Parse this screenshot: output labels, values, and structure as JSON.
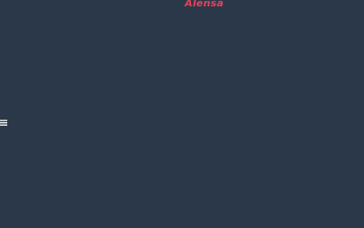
{
  "header": {
    "brand": "Alensa",
    "brand_color": "#e8405a"
  },
  "nav": {
    "menu_icon": "hamburger-menu-icon"
  },
  "theme": {
    "background": "#2a3849",
    "icon_color": "#ffffff"
  }
}
